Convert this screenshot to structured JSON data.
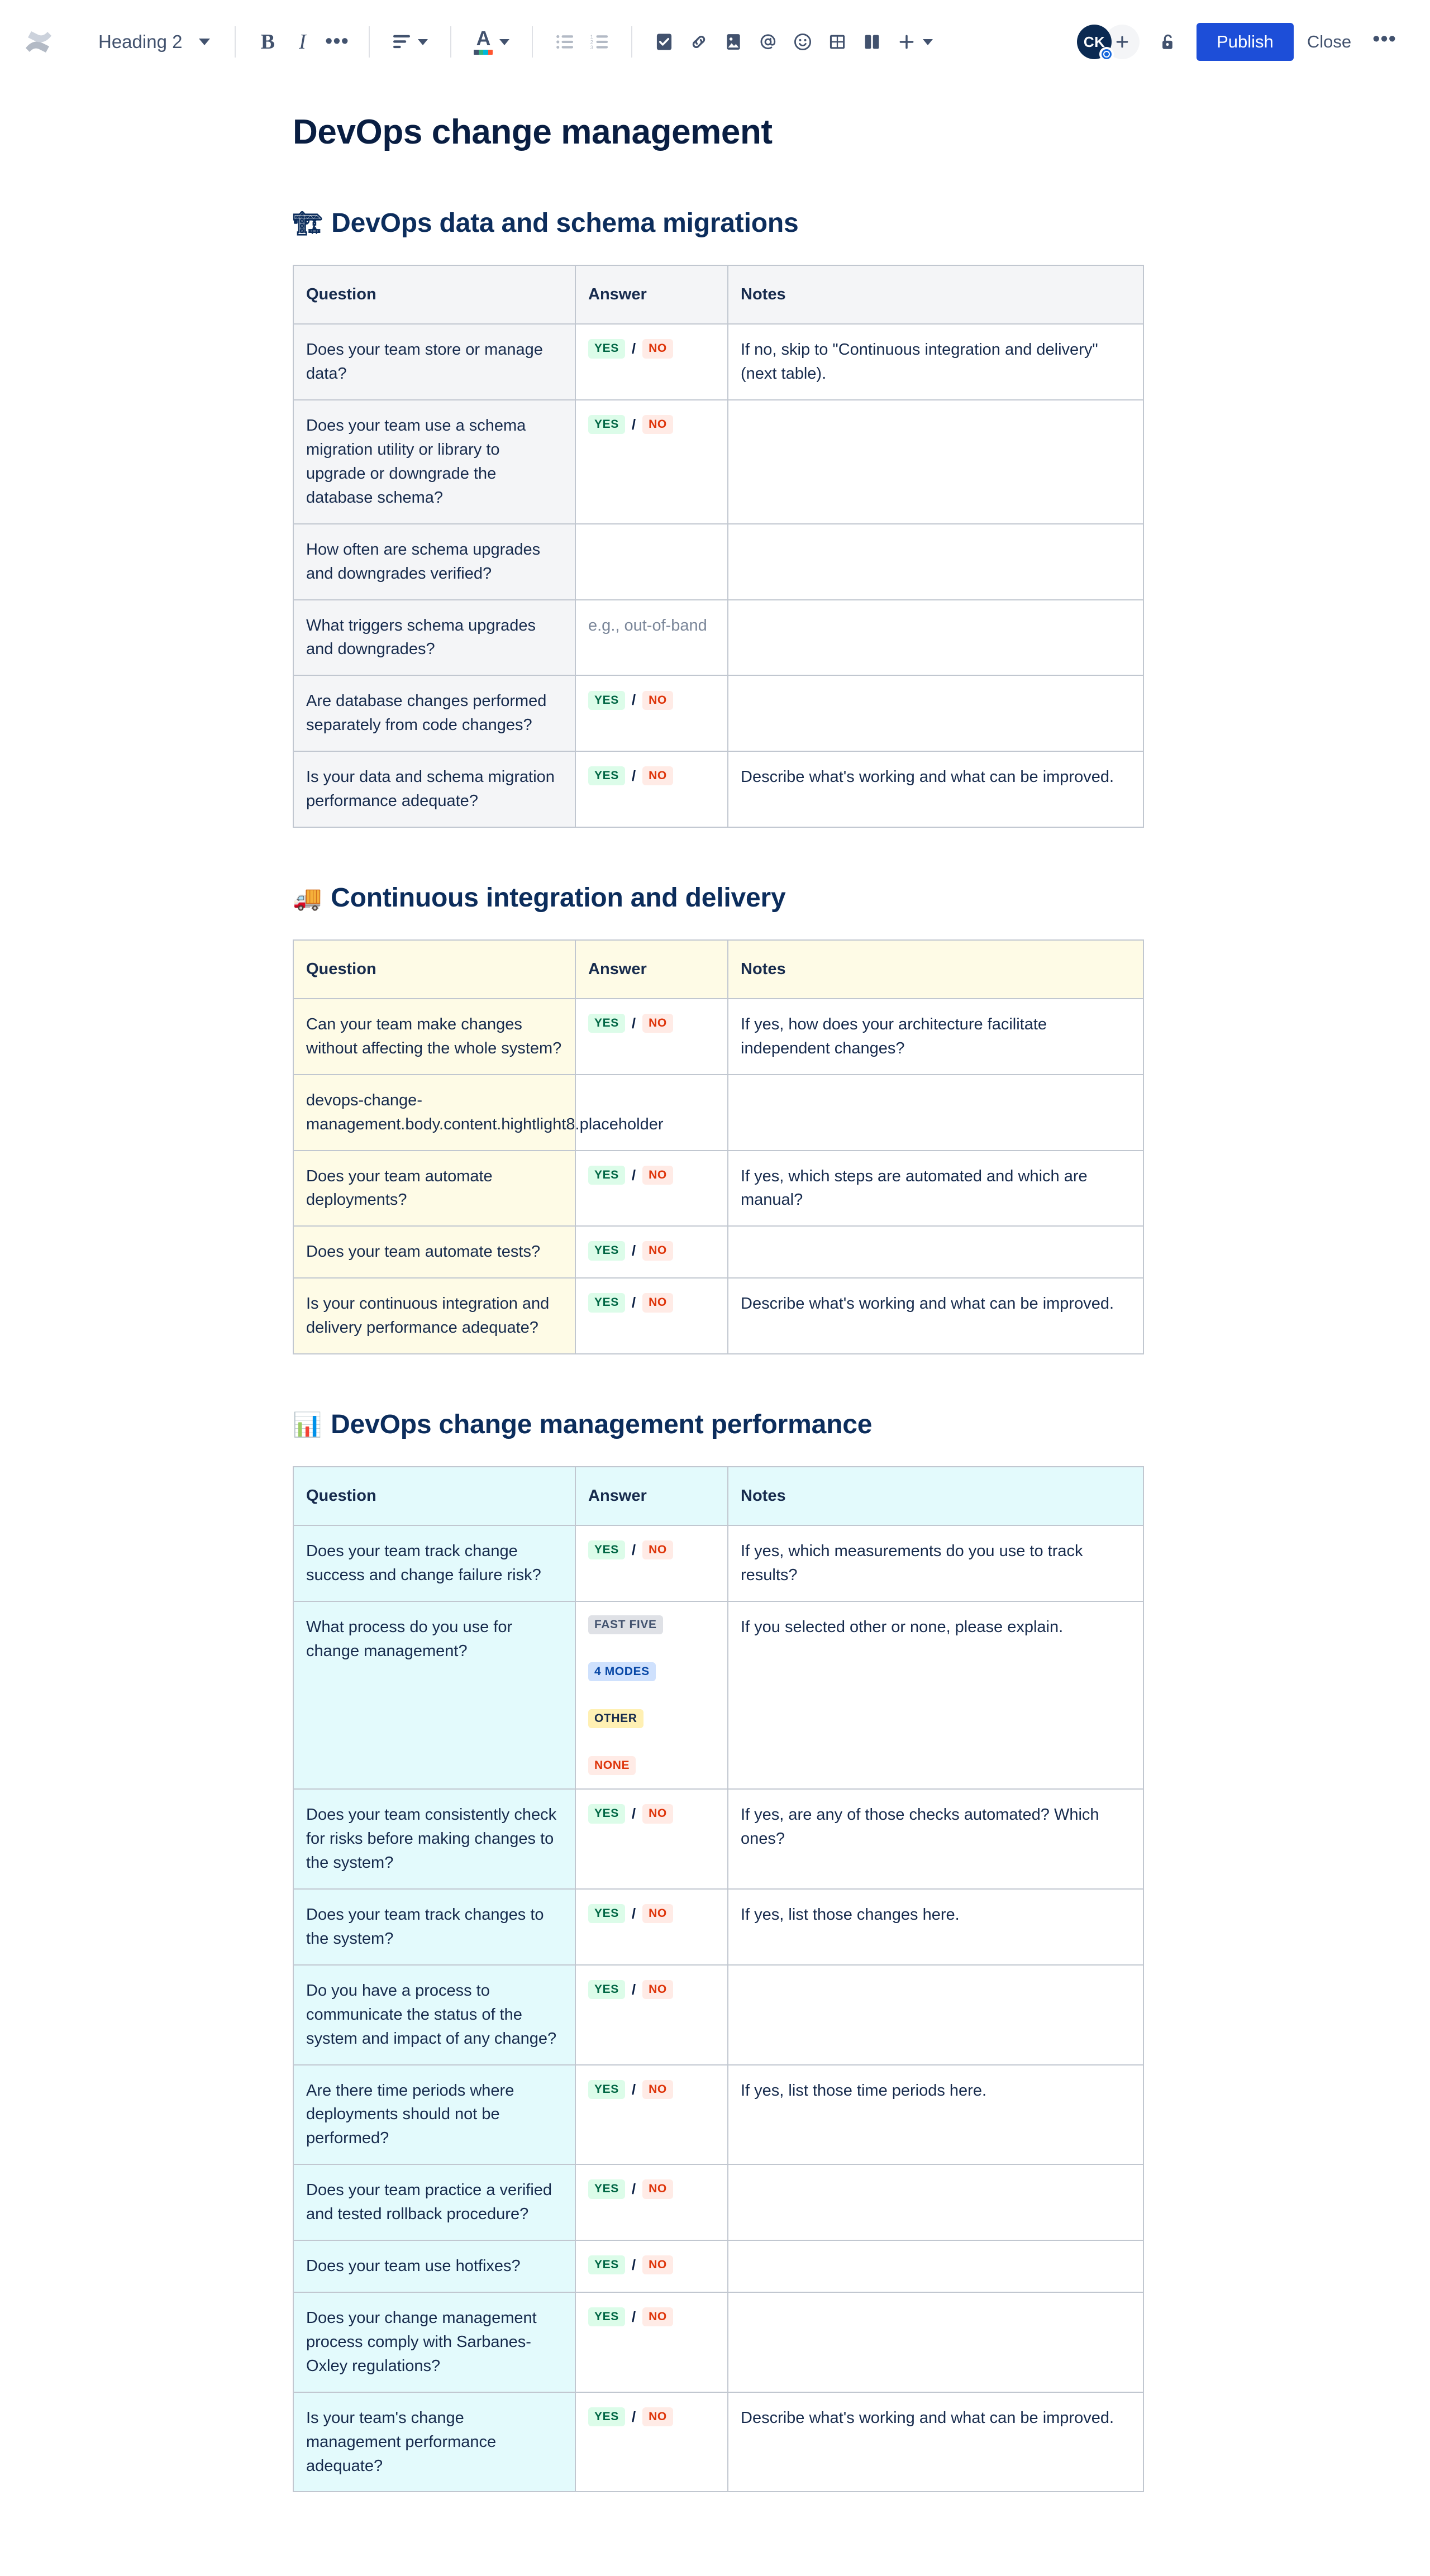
{
  "toolbar": {
    "logo_icon": "confluence-logo-icon",
    "style_select": {
      "label": "Heading 2",
      "icon": "chevron-down-icon"
    },
    "bold_label": "B",
    "italic_label": "I",
    "more_formatting_label": "•••",
    "align_icon": "text-align-icon",
    "text_color_label": "A",
    "bullet_list_icon": "bullet-list-icon",
    "numbered_list_icon": "numbered-list-icon",
    "task_icon": "checkbox-task-icon",
    "link_icon": "link-icon",
    "image_icon": "image-icon",
    "mention_icon": "mention-at-icon",
    "emoji_icon": "emoji-smiley-icon",
    "table_icon": "table-icon",
    "layout_icon": "page-layout-icon",
    "insert_icon": "plus-insert-icon",
    "avatar_initials": "CK",
    "invite_label": "+",
    "restrictions_icon": "unlocked-padlock-icon",
    "publish_label": "Publish",
    "close_label": "Close",
    "more_label": "•••",
    "accent_color": "#1d4ed8"
  },
  "document": {
    "title": "DevOps change management",
    "sections": [
      {
        "emoji": "🏗",
        "emoji_name": "building-construction-emoji",
        "heading": "DevOps data and schema migrations",
        "theme": "t-gray",
        "headers": [
          "Question",
          "Answer",
          "Notes"
        ],
        "rows": [
          {
            "question": "Does your team store or manage data?",
            "answer_type": "yesno",
            "answer": [
              "YES",
              "NO"
            ],
            "note": "If no, skip to \"Continuous integration and delivery\" (next table)."
          },
          {
            "question": "Does your team use a schema migration utility or library to upgrade or downgrade the database schema?",
            "answer_type": "yesno",
            "answer": [
              "YES",
              "NO"
            ],
            "note": ""
          },
          {
            "question": "How often are schema upgrades and downgrades verified?",
            "answer_type": "none",
            "answer": [],
            "note": ""
          },
          {
            "question": "What triggers schema upgrades and downgrades?",
            "answer_type": "ghost",
            "answer_text": "e.g., out-of-band",
            "note": ""
          },
          {
            "question": "Are database changes performed separately from code changes?",
            "answer_type": "yesno",
            "answer": [
              "YES",
              "NO"
            ],
            "note": ""
          },
          {
            "question": "Is your data and schema migration performance adequate?",
            "answer_type": "yesno",
            "answer": [
              "YES",
              "NO"
            ],
            "note": "Describe what's working and what can be improved."
          }
        ]
      },
      {
        "emoji": "🚚",
        "emoji_name": "delivery-truck-emoji",
        "heading": "Continuous integration and delivery",
        "theme": "t-cream",
        "headers": [
          "Question",
          "Answer",
          "Notes"
        ],
        "rows": [
          {
            "question": "Can your team make changes without affecting the whole system?",
            "answer_type": "yesno",
            "answer": [
              "YES",
              "NO"
            ],
            "note": "If yes, how does your architecture facilitate independent changes?"
          },
          {
            "question": "devops-change-management.body.content.hightlight8.placeholder",
            "answer_type": "none",
            "answer": [],
            "note": ""
          },
          {
            "question": "Does your team automate deployments?",
            "answer_type": "yesno",
            "answer": [
              "YES",
              "NO"
            ],
            "note": "If yes, which steps are automated and which are manual?"
          },
          {
            "question": "Does your team automate tests?",
            "answer_type": "yesno",
            "answer": [
              "YES",
              "NO"
            ],
            "note": ""
          },
          {
            "question": "Is your continuous integration and delivery performance adequate?",
            "answer_type": "yesno",
            "answer": [
              "YES",
              "NO"
            ],
            "note": "Describe what's working and what can be improved."
          }
        ]
      },
      {
        "emoji": "📊",
        "emoji_name": "bar-chart-emoji",
        "heading": "DevOps change management performance",
        "theme": "t-cyan",
        "headers": [
          "Question",
          "Answer",
          "Notes"
        ],
        "rows": [
          {
            "question": "Does your team track change success and change failure risk?",
            "answer_type": "yesno",
            "answer": [
              "YES",
              "NO"
            ],
            "note": "If yes, which measurements do you use to track results?"
          },
          {
            "question": "What process do you use for change management?",
            "answer_type": "options",
            "options": [
              {
                "label": "FAST FIVE",
                "color": "lz-gray"
              },
              {
                "label": "4 MODES",
                "color": "lz-blue"
              },
              {
                "label": "OTHER",
                "color": "lz-yellow"
              },
              {
                "label": "NONE",
                "color": "lz-red"
              }
            ],
            "note": "If you selected other or none, please explain."
          },
          {
            "question": "Does your team consistently check for risks before making changes to the system?",
            "answer_type": "yesno",
            "answer": [
              "YES",
              "NO"
            ],
            "note": "If yes, are any of those checks automated? Which ones?"
          },
          {
            "question": "Does your team track changes to the system?",
            "answer_type": "yesno",
            "answer": [
              "YES",
              "NO"
            ],
            "note": "If yes, list those changes here."
          },
          {
            "question": "Do you have a process to communicate the status of the system and impact of any change?",
            "answer_type": "yesno",
            "answer": [
              "YES",
              "NO"
            ],
            "note": ""
          },
          {
            "question": "Are there time periods where deployments should not be performed?",
            "answer_type": "yesno",
            "answer": [
              "YES",
              "NO"
            ],
            "note": "If yes, list those time periods here."
          },
          {
            "question": "Does your team practice a verified and tested rollback procedure?",
            "answer_type": "yesno",
            "answer": [
              "YES",
              "NO"
            ],
            "note": ""
          },
          {
            "question": "Does your team use hotfixes?",
            "answer_type": "yesno",
            "answer": [
              "YES",
              "NO"
            ],
            "note": ""
          },
          {
            "question": "Does your change management process comply with Sarbanes-Oxley regulations?",
            "answer_type": "yesno",
            "answer": [
              "YES",
              "NO"
            ],
            "note": ""
          },
          {
            "question": "Is your team's change management performance adequate?",
            "answer_type": "yesno",
            "answer": [
              "YES",
              "NO"
            ],
            "note": "Describe what's working and what can be improved."
          }
        ]
      }
    ]
  }
}
